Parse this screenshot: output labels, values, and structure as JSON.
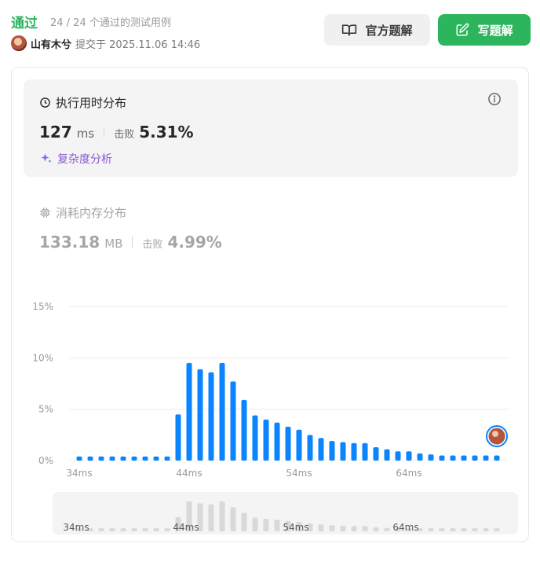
{
  "header": {
    "status": "通过",
    "tests_passed": "24 / 24 个通过的测试用例",
    "username": "山有木兮",
    "submitted": "提交于 2025.11.06 14:46",
    "solution_button": "官方题解",
    "write_button": "写题解"
  },
  "runtime": {
    "title": "执行用时分布",
    "value": "127",
    "unit": "ms",
    "beat_label": "击败",
    "beat_value": "5.31%",
    "complexity_link": "复杂度分析"
  },
  "memory": {
    "title": "消耗内存分布",
    "value": "133.18",
    "unit": "MB",
    "beat_label": "击败",
    "beat_value": "4.99%"
  },
  "colors": {
    "accent_green": "#2db55d",
    "bar_blue": "#0a84ff",
    "complexity_purple": "#8a5ad6"
  },
  "chart_data": {
    "type": "bar",
    "x_start_ms": 34,
    "x_step_ms": 1,
    "x_tick_labels": [
      "34ms",
      "44ms",
      "54ms",
      "64ms"
    ],
    "y_tick_labels": [
      "15%",
      "10%",
      "5%",
      "0%"
    ],
    "ylim": [
      0,
      15
    ],
    "values": [
      0.4,
      0.4,
      0.4,
      0.4,
      0.4,
      0.4,
      0.4,
      0.4,
      0.4,
      4.5,
      9.5,
      8.9,
      8.6,
      9.5,
      7.7,
      5.9,
      4.4,
      4.0,
      3.7,
      3.3,
      3.0,
      2.5,
      2.2,
      1.9,
      1.8,
      1.7,
      1.7,
      1.3,
      1.1,
      0.9,
      0.9,
      0.7,
      0.6,
      0.5,
      0.5,
      0.5,
      0.5,
      0.5,
      0.5
    ],
    "mini_values": [
      0.4,
      0.4,
      0.4,
      0.4,
      0.4,
      0.4,
      0.4,
      0.4,
      0.4,
      4.5,
      9.5,
      8.9,
      8.6,
      9.5,
      7.7,
      5.9,
      4.4,
      4.0,
      3.7,
      3.3,
      3.0,
      2.5,
      2.2,
      1.9,
      1.8,
      1.7,
      1.7,
      1.3,
      1.1,
      0.9,
      0.9,
      0.7,
      0.6,
      0.5,
      0.5,
      0.5,
      0.5,
      0.5,
      0.5
    ],
    "grid": true,
    "user_marker": "avatar on final bar"
  }
}
